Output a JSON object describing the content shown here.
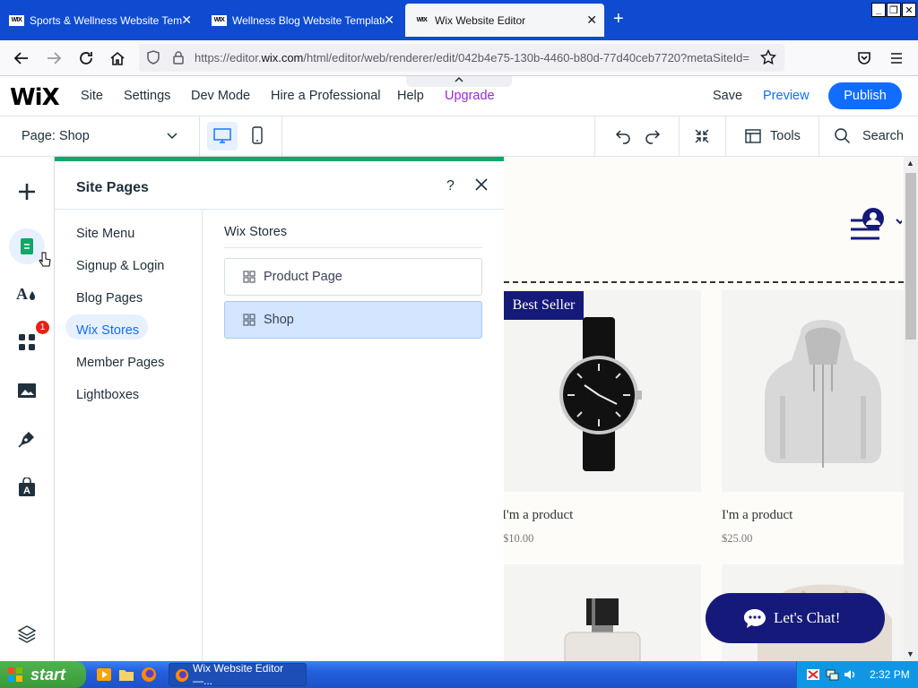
{
  "browser": {
    "tabs": [
      {
        "title": "Sports & Wellness Website Template",
        "favicon": "WIX",
        "active": false
      },
      {
        "title": "Wellness Blog Website Template | W",
        "favicon": "WIX",
        "active": false
      },
      {
        "title": "Wix Website Editor",
        "favicon": "WIX",
        "active": true
      }
    ],
    "url_prefix": "https://editor.",
    "url_domain": "wix.com",
    "url_rest": "/html/editor/web/renderer/edit/042b4e75-130b-4460-b80d-77d40ceb7720?metaSiteId="
  },
  "wix_topbar": {
    "logo": "WiX",
    "menu": [
      "Site",
      "Settings",
      "Dev Mode",
      "Hire a Professional",
      "Help",
      "Upgrade"
    ],
    "save": "Save",
    "preview": "Preview",
    "publish": "Publish"
  },
  "pagebar": {
    "page_label": "Page:",
    "page_value": "Shop",
    "tools": "Tools",
    "search": "Search"
  },
  "leftrail": {
    "badge": "1"
  },
  "panel": {
    "title": "Site Pages",
    "help": "?",
    "categories": [
      "Site Menu",
      "Signup & Login",
      "Blog Pages",
      "Wix Stores",
      "Member Pages",
      "Lightboxes"
    ],
    "active_category": "Wix Stores",
    "section_title": "Wix Stores",
    "pages": [
      {
        "label": "Product Page",
        "selected": false
      },
      {
        "label": "Shop",
        "selected": true
      }
    ]
  },
  "canvas": {
    "badge": "Best Seller",
    "products": [
      {
        "name": "I'm a product",
        "price": "$10.00"
      },
      {
        "name": "I'm a product",
        "price": "$25.00"
      }
    ],
    "chat": "Let's Chat!"
  },
  "taskbar": {
    "start": "start",
    "task": "Wix Website Editor —...",
    "clock": "2:32 PM"
  },
  "colors": {
    "accent": "#116dff",
    "panel_top": "#14a567",
    "brand_navy": "#151a7a",
    "upgrade": "#9a27d5"
  }
}
